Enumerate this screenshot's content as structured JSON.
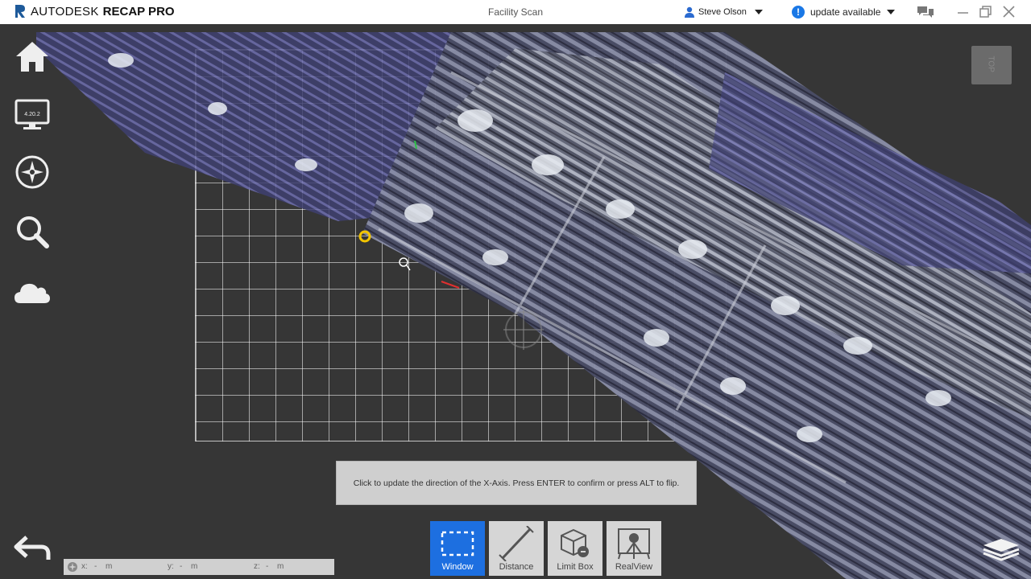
{
  "app": {
    "brand_name": "AUTODESK",
    "brand_product": "RECAP PRO",
    "document_title": "Facility Scan"
  },
  "header": {
    "user_name": "Steve Olson",
    "update_label": "update available",
    "update_icon_glyph": "!"
  },
  "nav": {
    "items": [
      {
        "name": "home-icon"
      },
      {
        "name": "monitor-icon",
        "badge": "4.20.2"
      },
      {
        "name": "compass-icon"
      },
      {
        "name": "search-icon"
      },
      {
        "name": "cloud-icon"
      }
    ]
  },
  "view_cube": {
    "label": "TOP"
  },
  "hint": {
    "text": "Click to update the direction of the X-Axis. Press ENTER to confirm or press ALT to flip."
  },
  "toolbar": {
    "tools": [
      {
        "label": "Window",
        "active": true,
        "icon": "window-select-icon"
      },
      {
        "label": "Distance",
        "active": false,
        "icon": "distance-icon"
      },
      {
        "label": "Limit Box",
        "active": false,
        "icon": "limit-box-icon"
      },
      {
        "label": "RealView",
        "active": false,
        "icon": "realview-icon"
      }
    ]
  },
  "coordinates": {
    "x_label": "x:",
    "x_value": "-",
    "x_unit": "m",
    "y_label": "y:",
    "y_value": "-",
    "y_unit": "m",
    "z_label": "z:",
    "z_value": "-",
    "z_unit": "m"
  },
  "colors": {
    "accent": "#1d6fe0",
    "update_icon": "#1a78e6",
    "background": "#363636",
    "tooltip": "#cfcfcf"
  }
}
